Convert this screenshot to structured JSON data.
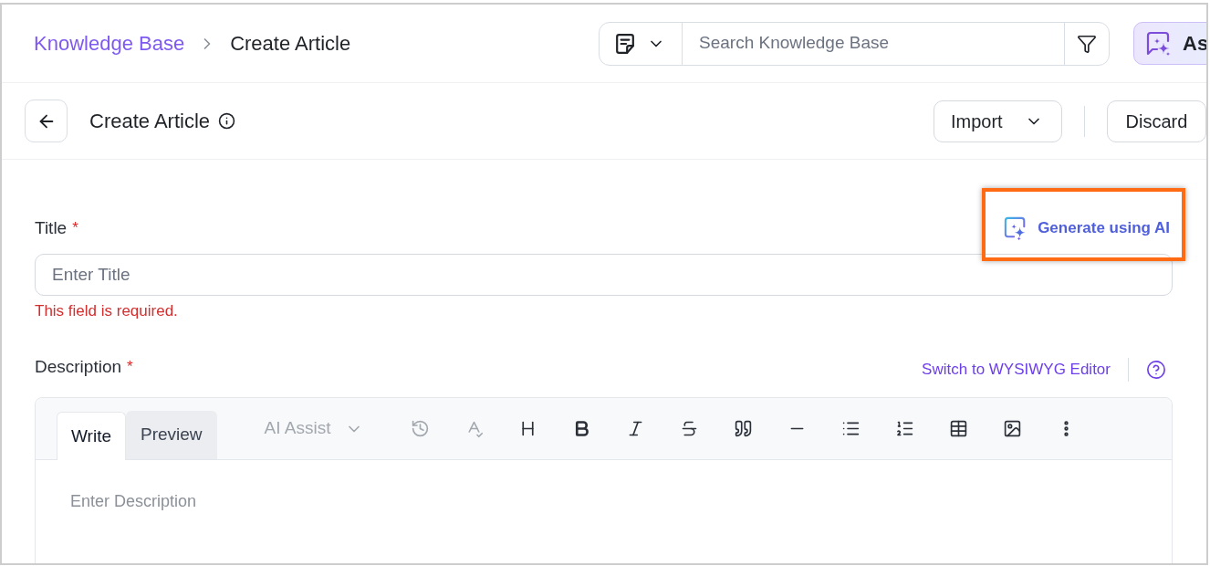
{
  "breadcrumb": [
    {
      "kind": "link",
      "label": "Knowledge Base"
    },
    {
      "kind": "current",
      "label": "Create Article"
    }
  ],
  "search": {
    "placeholder": "Search Knowledge Base"
  },
  "ask_button": {
    "label": "As"
  },
  "page_header": {
    "title": "Create Article"
  },
  "actions": [
    {
      "kind": "dropdown",
      "label": "Import"
    },
    {
      "kind": "button",
      "label": "Discard"
    }
  ],
  "title_field": {
    "label": "Title",
    "required_mark": "*",
    "placeholder": "Enter Title",
    "error": "This field is required."
  },
  "generate_ai": {
    "label": "Generate using AI",
    "highlighted": true
  },
  "description_field": {
    "label": "Description",
    "required_mark": "*",
    "editor_switch": "Switch to WYSIWYG Editor",
    "tabs": [
      {
        "label": "Write",
        "selected": true
      },
      {
        "label": "Preview",
        "selected": false
      }
    ],
    "ai_assist": {
      "label": "AI Assist",
      "disabled": true
    },
    "tools": [
      {
        "kind": "history",
        "disabled": true
      },
      {
        "kind": "spellcheck",
        "disabled": true
      },
      {
        "kind": "heading",
        "disabled": false
      },
      {
        "kind": "bold",
        "disabled": false
      },
      {
        "kind": "italic",
        "disabled": false
      },
      {
        "kind": "strike",
        "disabled": false
      },
      {
        "kind": "quote",
        "disabled": false
      },
      {
        "kind": "rule",
        "disabled": false
      },
      {
        "kind": "bullets",
        "disabled": false
      },
      {
        "kind": "numbered",
        "disabled": false
      },
      {
        "kind": "table",
        "disabled": false
      },
      {
        "kind": "image",
        "disabled": false
      },
      {
        "kind": "more",
        "disabled": false
      }
    ],
    "placeholder": "Enter Description"
  }
}
